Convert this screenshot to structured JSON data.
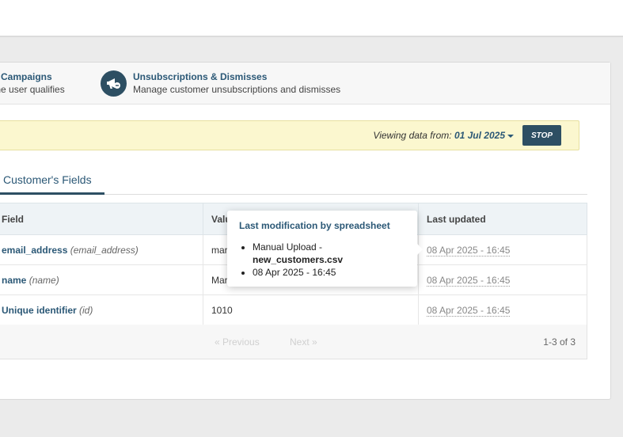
{
  "nav": {
    "items": [
      {
        "title": "e Campaigns",
        "subtitle": "the user qualifies"
      },
      {
        "title": "Unsubscriptions & Dismisses",
        "subtitle": "Manage customer unsubscriptions and dismisses",
        "icon": "megaphone-icon"
      }
    ]
  },
  "banner": {
    "label": "Viewing data from:",
    "date": "01 Jul 2025",
    "stop_label": "STOP",
    "background_color": "#fbf7cf"
  },
  "tabs": [
    {
      "label": "Customer's Fields",
      "active": true
    }
  ],
  "table": {
    "columns": [
      "Field",
      "Valu",
      "Last updated"
    ],
    "rows": [
      {
        "name": "email_address",
        "key": "(email_address)",
        "value": "mar",
        "updated": "08 Apr 2025 - 16:45"
      },
      {
        "name": "name",
        "key": "(name)",
        "value": "Mar",
        "updated": "08 Apr 2025 - 16:45"
      },
      {
        "name": "Unique identifier",
        "key": "(id)",
        "value": "1010",
        "updated": "08 Apr 2025 - 16:45"
      }
    ]
  },
  "pagination": {
    "previous": "« Previous",
    "next": "Next »",
    "count": "1-3 of 3"
  },
  "tooltip": {
    "title": "Last modification by spreadsheet",
    "source": "Manual Upload -",
    "file": "new_customers.csv",
    "date": "08 Apr 2025 - 16:45"
  },
  "colors": {
    "accent": "#2d4f63",
    "link": "#2b5876"
  }
}
